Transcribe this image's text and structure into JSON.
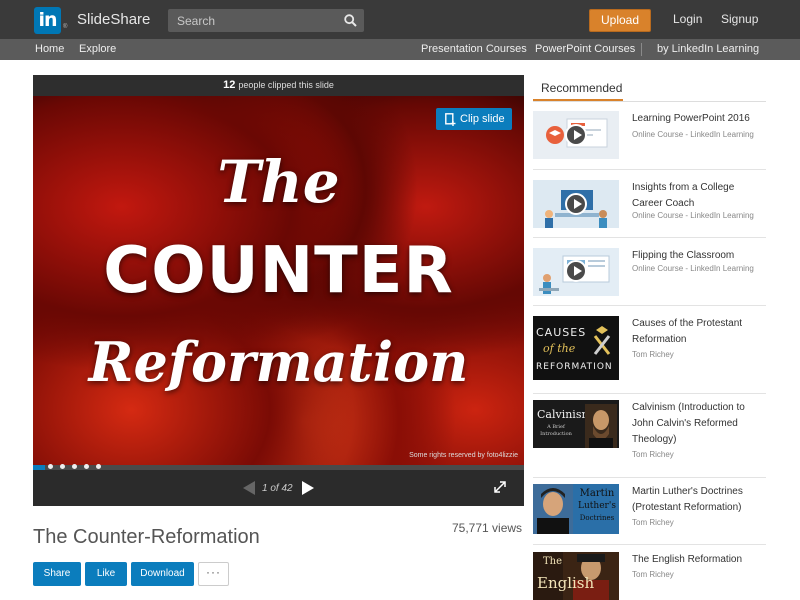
{
  "header": {
    "brand_logo": "in",
    "brand_name": "SlideShare",
    "search_placeholder": "Search",
    "upload_label": "Upload",
    "login_label": "Login",
    "signup_label": "Signup"
  },
  "subnav": {
    "home": "Home",
    "explore": "Explore",
    "presentation_courses": "Presentation Courses",
    "powerpoint_courses": "PowerPoint Courses",
    "linkedin_learning": "by LinkedIn Learning"
  },
  "player": {
    "clip_count": "12",
    "clip_text": "people clipped this slide",
    "clip_button": "Clip slide",
    "slide_title_line1": "The",
    "slide_title_line2": "COUNTER",
    "slide_title_line3": "Reformation",
    "slide_credit": "Some rights reserved by foto4lizzie",
    "page_indicator": "1 of 42",
    "progress_fraction": 0.024
  },
  "document": {
    "title": "The Counter-Reformation",
    "views": "75,771 views",
    "share_label": "Share",
    "like_label": "Like",
    "download_label": "Download",
    "more_label": "···"
  },
  "sidebar": {
    "header": "Recommended",
    "items": [
      {
        "title": "Learning PowerPoint 2016",
        "subtitle": "Online Course - LinkedIn Learning"
      },
      {
        "title": "Insights from a College Career Coach",
        "subtitle": "Online Course - LinkedIn Learning"
      },
      {
        "title": "Flipping the Classroom",
        "subtitle": "Online Course - LinkedIn Learning"
      },
      {
        "title": "Causes of the Protestant Reformation",
        "subtitle": "Tom Richey",
        "thumb_text": [
          "CAUSES",
          "of the",
          "REFORMATION"
        ]
      },
      {
        "title": "Calvinism (Introduction to John Calvin's Reformed Theology)",
        "subtitle": "Tom Richey",
        "thumb_text": [
          "Calvinism",
          "A Brief Introduction"
        ]
      },
      {
        "title": "Martin Luther's Doctrines (Protestant Reformation)",
        "subtitle": "Tom Richey",
        "thumb_text": [
          "Martin",
          "Luther's",
          "Doctrines"
        ]
      },
      {
        "title": "The English Reformation",
        "subtitle": "Tom Richey",
        "thumb_text": [
          "The",
          "English"
        ]
      }
    ]
  },
  "colors": {
    "linkedin_blue": "#0077b5",
    "upload_orange": "#d9822b",
    "action_blue": "#0b7dbd",
    "topbar": "#3a3a3a"
  }
}
